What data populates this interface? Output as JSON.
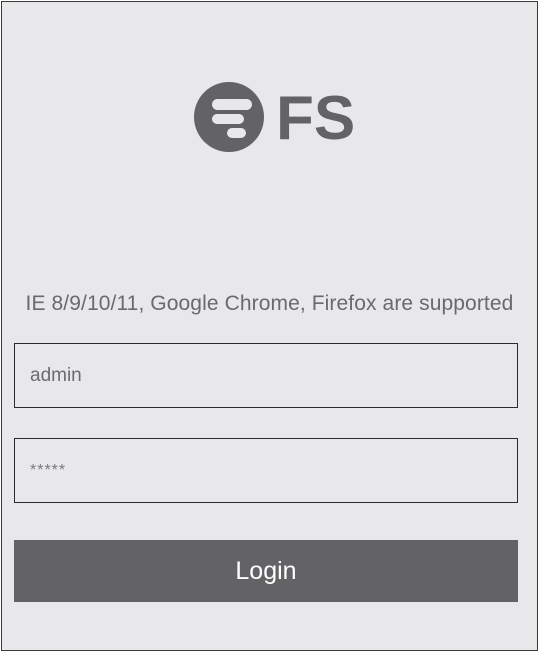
{
  "logo": {
    "text": "FS",
    "color": "#636366"
  },
  "support_note": "IE 8/9/10/11, Google Chrome, Firefox are supported",
  "username": {
    "value": "admin"
  },
  "password": {
    "value": "*****"
  },
  "login_button": {
    "label": "Login",
    "color": "#636366"
  },
  "colors": {
    "background": "#e8e8ea",
    "border": "#2c2c2c",
    "text": "#6a6a6c"
  }
}
